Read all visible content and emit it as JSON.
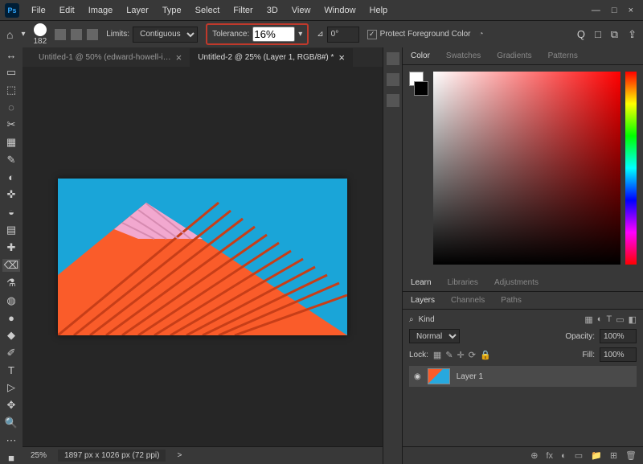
{
  "app": {
    "logo": "Ps"
  },
  "menu": [
    "File",
    "Edit",
    "Image",
    "Layer",
    "Type",
    "Select",
    "Filter",
    "3D",
    "View",
    "Window",
    "Help"
  ],
  "window": {
    "min": "—",
    "max": "□",
    "close": "×"
  },
  "options": {
    "home_icon": "⌂",
    "arrow_icon": "▾",
    "brush_size": "182",
    "limits_label": "Limits:",
    "limits_value": "Contiguous",
    "tolerance_label": "Tolerance:",
    "tolerance_value": "16%",
    "angle_icon": "⊿",
    "angle_value": "0°",
    "protect_check": "✓",
    "protect_label": "Protect Foreground Color",
    "right_icons": [
      "Q",
      "□",
      "⧉",
      "⇪"
    ]
  },
  "tools": [
    "↔",
    "▭",
    "⬚",
    "◌",
    "✂",
    "▦",
    "✎",
    "◐",
    "✜",
    "◒",
    "▤",
    "✚",
    "⌫",
    "⚗",
    "◍",
    "●",
    "◆",
    "✐",
    "T",
    "▷",
    "✥",
    "🔍",
    "⋯",
    "■"
  ],
  "active_tool_index": 12,
  "tabs": [
    {
      "label": "Untitled-1 @ 50% (edward-howell-i…",
      "active": false
    },
    {
      "label": "Untitled-2 @ 25% (Layer 1, RGB/8#) *",
      "active": true
    }
  ],
  "status": {
    "zoom": "25%",
    "docinfo": "1897 px x 1026 px (72 ppi)",
    "caret": ">"
  },
  "mini_panels": [
    "a",
    "b",
    "c"
  ],
  "color_tabs": [
    "Color",
    "Swatches",
    "Gradients",
    "Patterns"
  ],
  "learn_tabs": [
    "Learn",
    "Libraries",
    "Adjustments"
  ],
  "layer_tabs": [
    "Layers",
    "Channels",
    "Paths"
  ],
  "layers": {
    "kind_label": "Kind",
    "kind_value": "⌕",
    "filter_icons": [
      "▦",
      "◐",
      "T",
      "▭",
      "◧"
    ],
    "blend": "Normal",
    "opacity_label": "Opacity:",
    "opacity_value": "100%",
    "lock_label": "Lock:",
    "lock_icons": [
      "▦",
      "✎",
      "✛",
      "⟳",
      "🔒"
    ],
    "fill_label": "Fill:",
    "fill_value": "100%",
    "items": [
      {
        "name": "Layer 1"
      }
    ]
  },
  "footer_icons": [
    "⊕",
    "fx",
    "◐",
    "▭",
    "📁",
    "⊞",
    "🗑"
  ]
}
